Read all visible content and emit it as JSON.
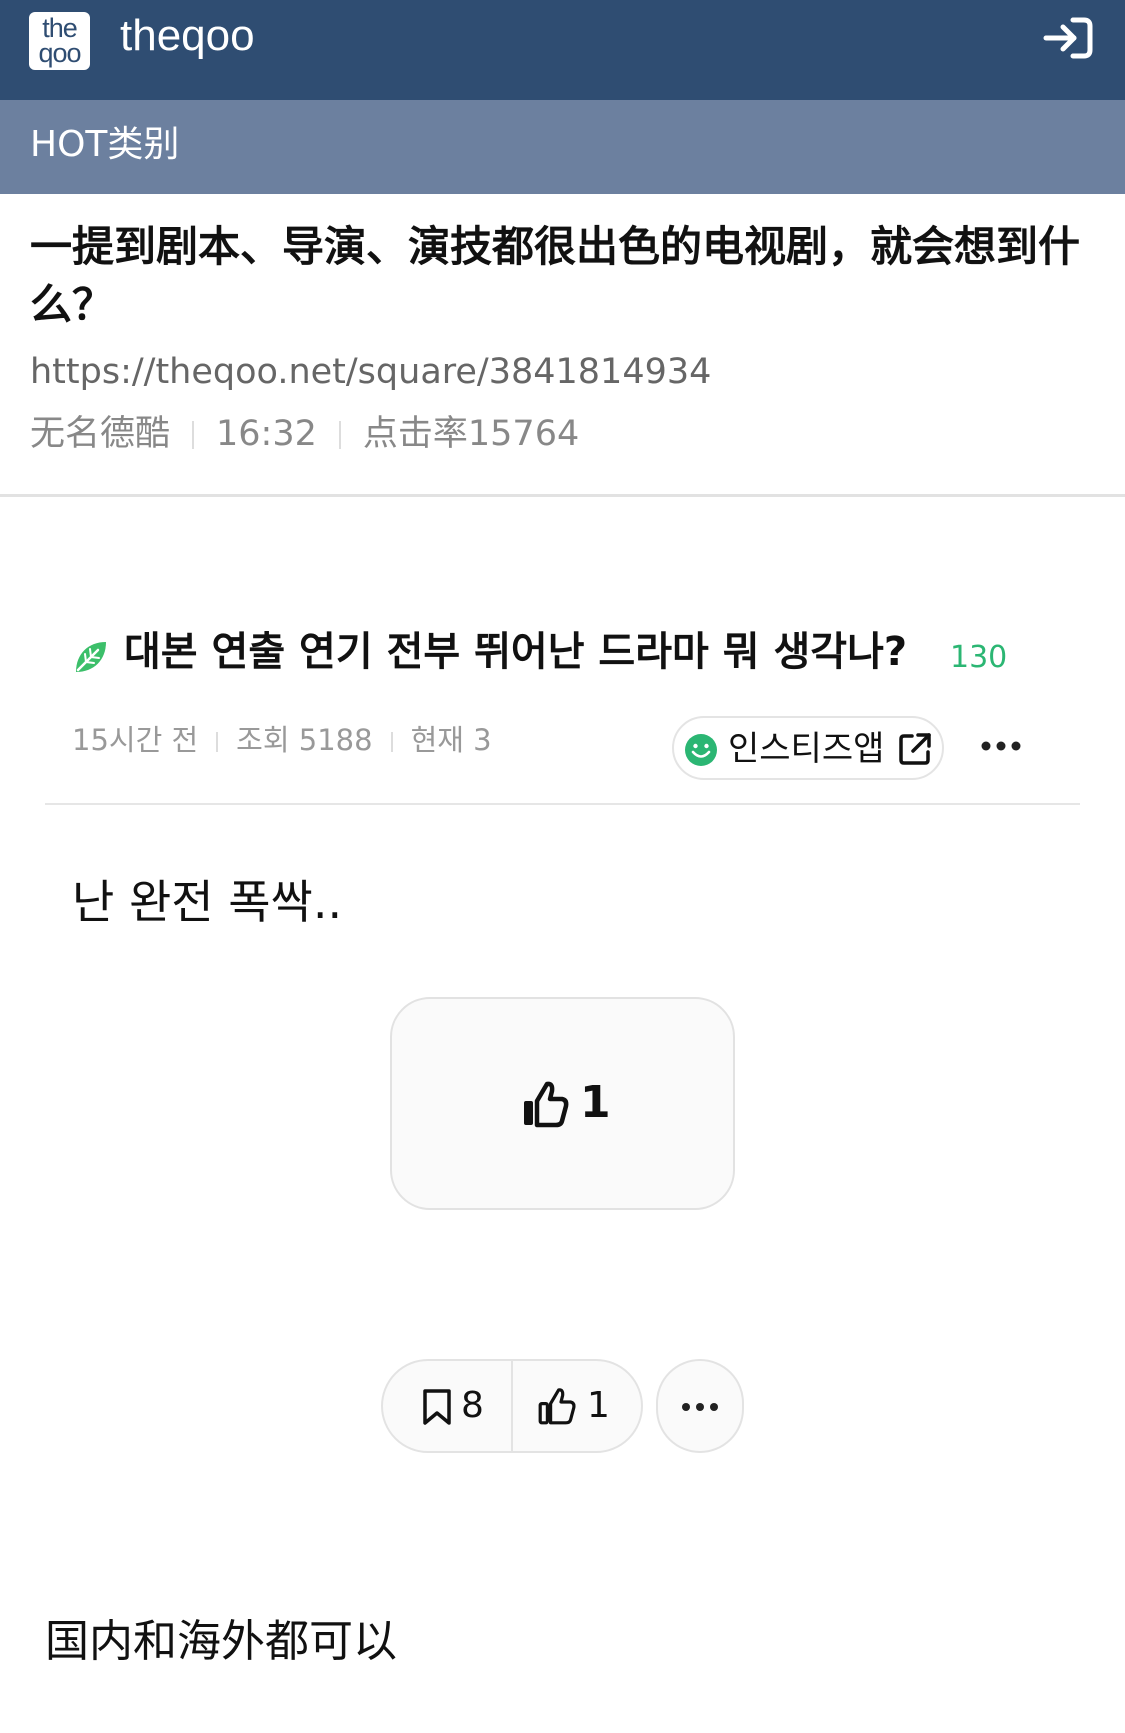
{
  "header": {
    "logo_line1": "the",
    "logo_line2": "qoo",
    "brand": "theqoo",
    "login_icon": "login-arrow-icon"
  },
  "category": {
    "label": "HOT类别"
  },
  "article": {
    "title": "一提到剧本、导演、演技都很出色的电视剧，就会想到什么？",
    "url": "https://theqoo.net/square/3841814934",
    "author": "无名德酷",
    "time": "16:32",
    "views": "点击率15764"
  },
  "embedded_post": {
    "leaf_icon": "leaf-icon",
    "title": "대본 연출 연기 전부 뛰어난 드라마 뭐 생각나?",
    "comment_count": "130",
    "time_ago": "15시간 전",
    "views": "조회 5188",
    "current": "현재 3",
    "app_button_label": "인스티즈앱",
    "body": "난 완전 폭싹..",
    "like_count": "1",
    "bookmark_count": "8",
    "like_count_bottom": "1"
  },
  "footer": {
    "text": "国内和海外都可以"
  },
  "colors": {
    "topbar": "#2f4d72",
    "category_bar": "#6c809f",
    "accent_green": "#2bb673"
  }
}
